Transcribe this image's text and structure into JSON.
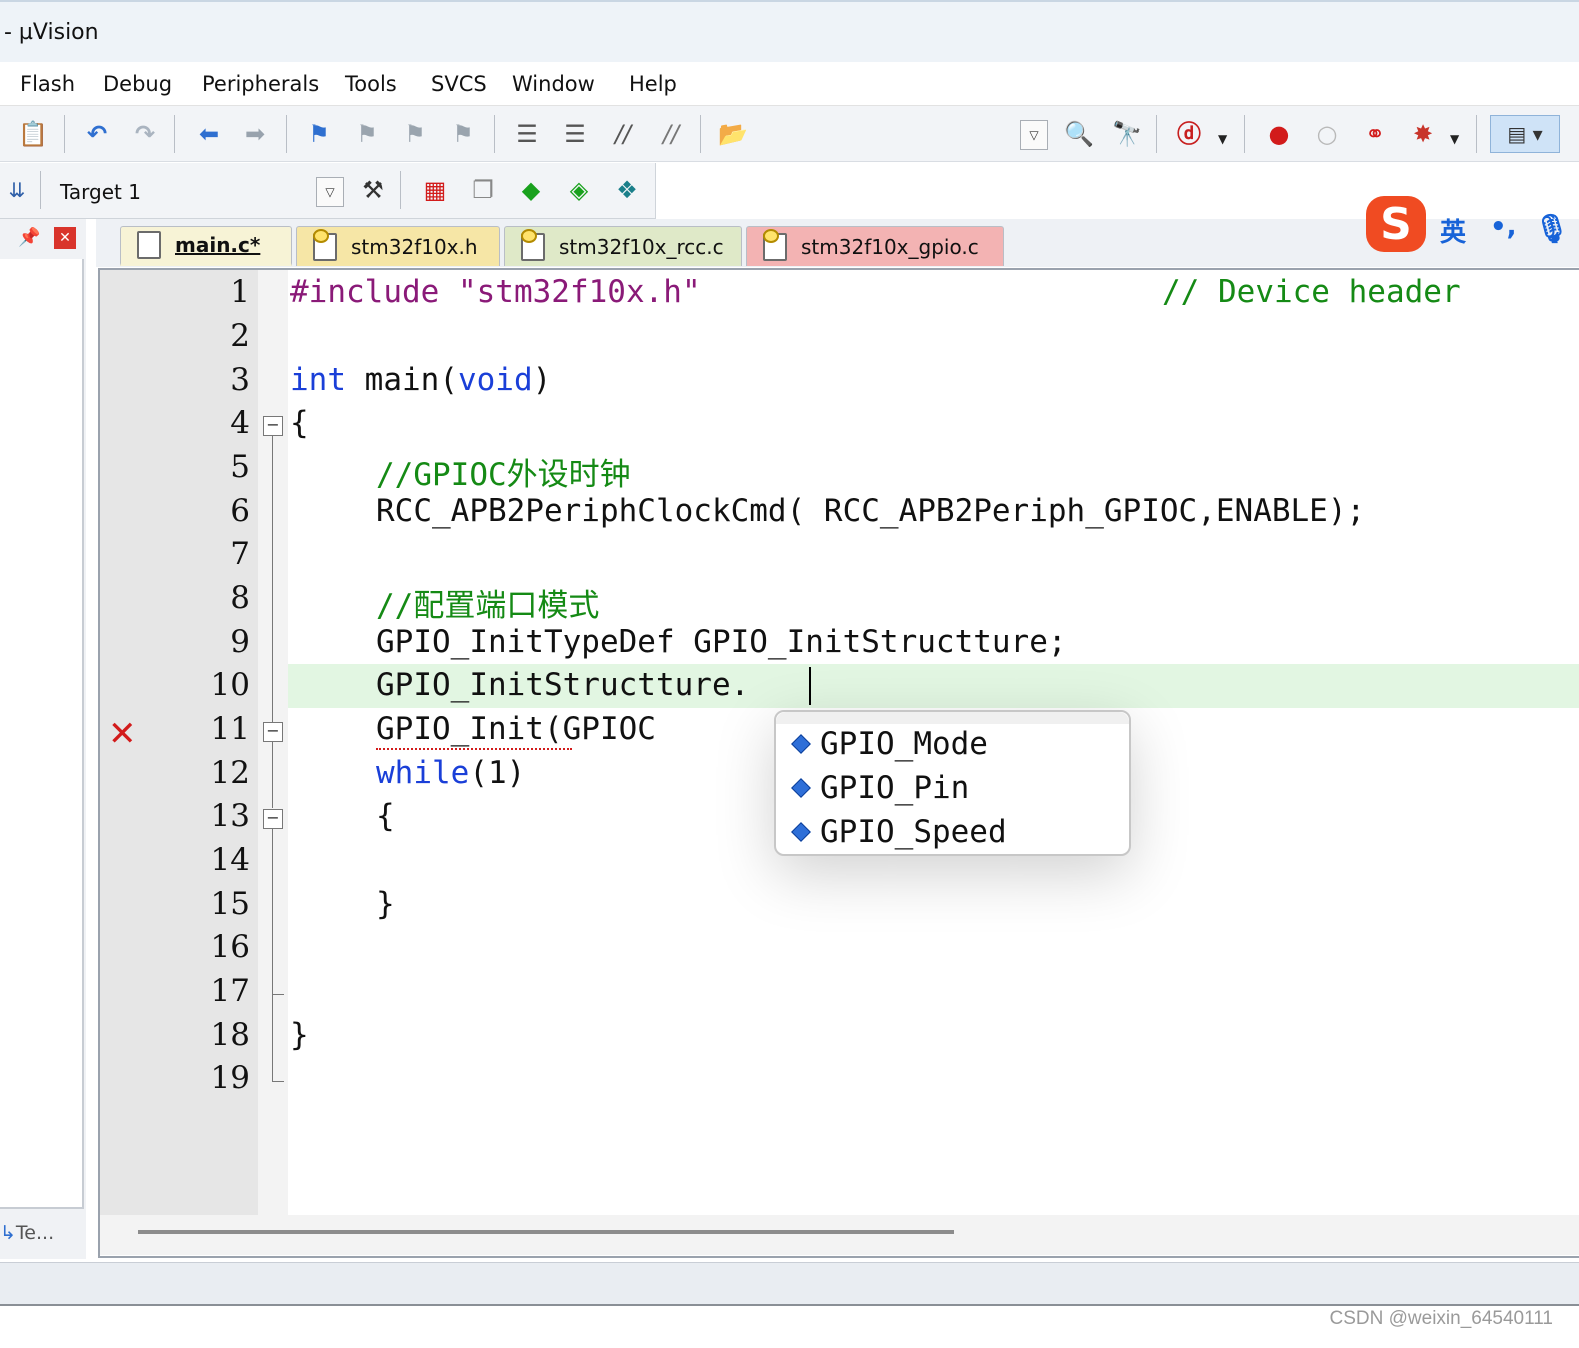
{
  "window": {
    "title": "- µVision"
  },
  "menu": [
    "Flash",
    "Debug",
    "Peripherals",
    "Tools",
    "SVCS",
    "Window",
    "Help"
  ],
  "toolbar": {
    "target": "Target 1",
    "icons": [
      "paste-icon",
      "undo-icon",
      "redo-icon",
      "nav-back-icon",
      "nav-forward-icon",
      "bookmark-icon",
      "bookmark-prev-icon",
      "bookmark-next-icon",
      "bookmark-clear-icon",
      "indent-icon",
      "unindent-icon",
      "comment-icon",
      "uncomment-icon",
      "open-folder-icon",
      "find-in-files-icon",
      "find-icon",
      "debug-icon",
      "breakpoint-icon",
      "breakpoint-disable-icon",
      "breakpoint-kill-icon",
      "breakpoints-icon",
      "window-layout-icon",
      "load-icon",
      "target-options-icon",
      "manage-project-icon",
      "run-time-env-icon",
      "pack-installer-icon",
      "select-packs-icon"
    ]
  },
  "panel": {
    "bottom_tab": "Te..."
  },
  "tabs": [
    {
      "label": "main.c*",
      "active": true,
      "color": "#f7f3d6"
    },
    {
      "label": "stm32f10x.h",
      "color": "#f6e6a6"
    },
    {
      "label": "stm32f10x_rcc.c",
      "color": "#dfe9c8"
    },
    {
      "label": "stm32f10x_gpio.c",
      "color": "#f3b3b3"
    }
  ],
  "ime": {
    "lang": "英",
    "punct": "•,"
  },
  "editor": {
    "line_numbers": [
      "1",
      "2",
      "3",
      "4",
      "5",
      "6",
      "7",
      "8",
      "9",
      "10",
      "11",
      "12",
      "13",
      "14",
      "15",
      "16",
      "17",
      "18",
      "19"
    ],
    "code": {
      "l1_pp": "#include",
      "l1_str": "\"stm32f10x.h\"",
      "l1_cm": "// Device header",
      "l3_kw1": "int",
      "l3_fn": " main(",
      "l3_kw2": "void",
      "l3_end": ")",
      "l4": "{",
      "l5_cm": "//GPIOC外设时钟",
      "l6": "RCC_APB2PeriphClockCmd( RCC_APB2Periph_GPIOC,ENABLE);",
      "l8_cm": "//配置端口模式",
      "l9": "GPIO_InitTypeDef GPIO_InitStructture;",
      "l10": "GPIO_InitStructture.",
      "l11": "GPIO_Init(GPIOC",
      "l12_kw": "while",
      "l12_rest": "(1)",
      "l13": "{",
      "l15": "}",
      "l18": "}"
    },
    "completion": [
      "GPIO_Mode",
      "GPIO_Pin",
      "GPIO_Speed"
    ]
  },
  "watermark": "CSDN @weixin_64540111"
}
